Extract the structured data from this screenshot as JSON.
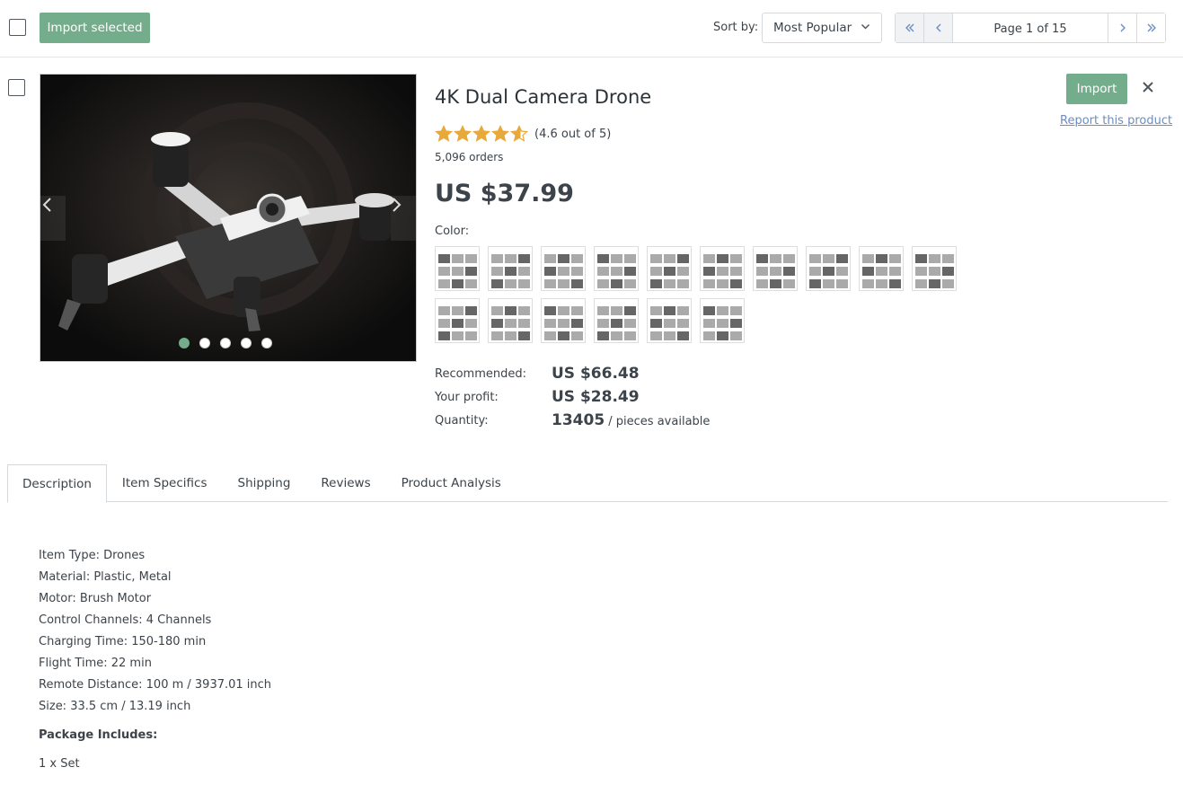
{
  "toolbar": {
    "import_selected_label": "Import selected",
    "sort_label": "Sort by:",
    "sort_value": "Most Popular",
    "page_text": "Page 1 of 15"
  },
  "product": {
    "title": "4K Dual Camera Drone",
    "rating": 4.6,
    "rating_text": "(4.6 out of 5)",
    "orders": "5,096 orders",
    "price": "US $37.99",
    "color_label": "Color:",
    "swatch_count": 16,
    "gallery_image_count": 5,
    "gallery_active_index": 0,
    "recommended_label": "Recommended:",
    "recommended_value": "US $66.48",
    "profit_label": "Your profit:",
    "profit_value": "US $28.49",
    "quantity_label": "Quantity:",
    "quantity_value": "13405",
    "quantity_suffix": " / pieces available",
    "import_label": "Import",
    "report_label": "Report this product"
  },
  "tabs": [
    {
      "label": "Description",
      "active": true
    },
    {
      "label": "Item Specifics",
      "active": false
    },
    {
      "label": "Shipping",
      "active": false
    },
    {
      "label": "Reviews",
      "active": false
    },
    {
      "label": "Product Analysis",
      "active": false
    }
  ],
  "description": {
    "lines": [
      "Item Type: Drones",
      "Material: Plastic, Metal",
      "Motor: Brush Motor",
      "Control Channels: 4 Channels",
      "Charging Time: 150-180 min",
      "Flight Time: 22 min",
      "Remote Distance: 100 m / 3937.01 inch",
      "Size: 33.5 cm / 13.19 inch"
    ],
    "package_heading": "Package Includes:",
    "package_item": "1 x Set"
  },
  "colors": {
    "accent": "#73ad8b",
    "link": "#6c8dbf",
    "star": "#e8a93b"
  }
}
